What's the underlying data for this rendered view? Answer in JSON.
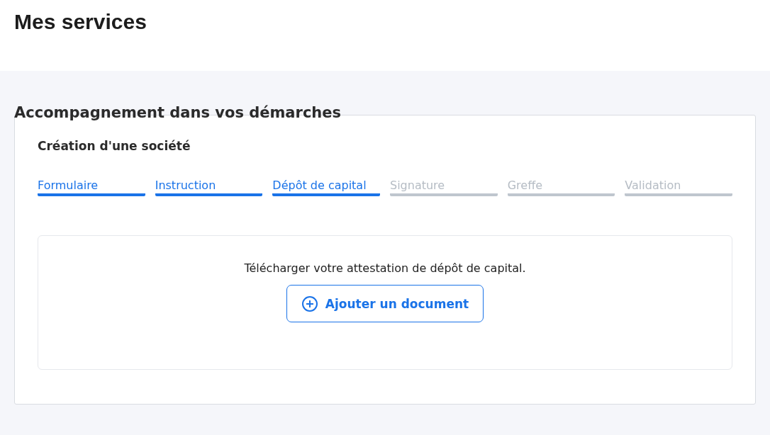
{
  "page_title": "Mes services",
  "section": {
    "title": "Accompagnement dans vos démarches",
    "card": {
      "title": "Création d'une société",
      "steps": [
        {
          "label": "Formulaire",
          "done": true
        },
        {
          "label": "Instruction",
          "done": true
        },
        {
          "label": "Dépôt de capital",
          "done": true
        },
        {
          "label": "Signature",
          "done": false
        },
        {
          "label": "Greffe",
          "done": false
        },
        {
          "label": "Validation",
          "done": false
        }
      ],
      "upload": {
        "message": "Télécharger votre attestation de dépôt de capital.",
        "button": "Ajouter un document"
      }
    }
  }
}
